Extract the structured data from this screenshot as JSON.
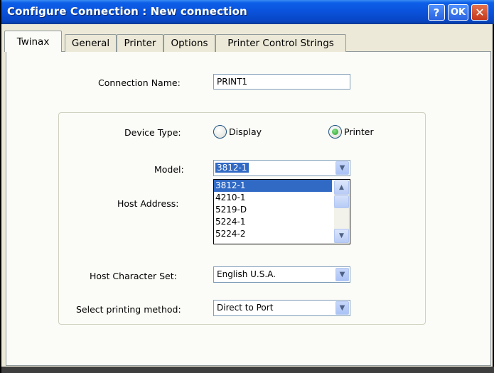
{
  "window": {
    "title": "Configure Connection : New connection",
    "help_label": "?",
    "ok_label": "OK",
    "close_label": "✕"
  },
  "tabs": [
    {
      "label": "Twinax",
      "active": true
    },
    {
      "label": "General",
      "active": false
    },
    {
      "label": "Printer",
      "active": false
    },
    {
      "label": "Options",
      "active": false
    },
    {
      "label": "Printer Control Strings",
      "active": false
    }
  ],
  "form": {
    "connection_name_label": "Connection Name:",
    "connection_name_value": "PRINT1",
    "device_type_label": "Device Type:",
    "device_type_options": [
      {
        "label": "Display",
        "checked": false
      },
      {
        "label": "Printer",
        "checked": true
      }
    ],
    "model_label": "Model:",
    "model_value": "3812-1",
    "model_list": [
      "3812-1",
      "4210-1",
      "5219-D",
      "5224-1",
      "5224-2"
    ],
    "model_list_selected": "3812-1",
    "host_address_label": "Host Address:",
    "host_charset_label": "Host Character Set:",
    "host_charset_value": "English U.S.A.",
    "printing_method_label": "Select printing method:",
    "printing_method_value": "Direct to Port"
  },
  "icons": {
    "dropdown": "chevron-down-icon",
    "scroll_up": "arrow-up-icon",
    "scroll_down": "arrow-down-icon"
  },
  "colors": {
    "titlebar": "#0a52db",
    "selection": "#316ac5",
    "radio_checked": "#21a121"
  }
}
